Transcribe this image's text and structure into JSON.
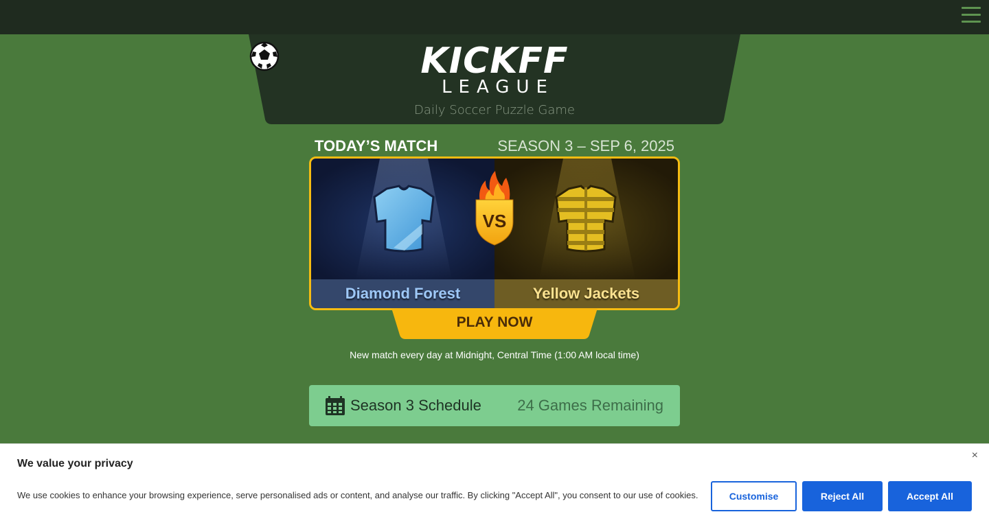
{
  "header": {
    "logo_word_part1": "KICK",
    "logo_word_part2": "FF",
    "logo_league": "LEAGUE",
    "tagline": "Daily Soccer Puzzle Game",
    "menu_icon": "hamburger-menu-icon"
  },
  "match": {
    "heading": "TODAY’S MATCH",
    "season_date": "SEASON 3 – SEP 6, 2025",
    "home_team": "Diamond Forest",
    "away_team": "Yellow Jackets",
    "vs_label": "VS",
    "play_label": "PLAY NOW",
    "info": "New match every day at Midnight, Central Time (1:00 AM local time)",
    "colors": {
      "home_jersey": "#62b3e6",
      "away_jersey": "#e4be22",
      "accent": "#f6bc12"
    }
  },
  "schedule": {
    "label": "Season 3 Schedule",
    "remaining": "24 Games Remaining",
    "icon": "calendar-icon"
  },
  "cookie": {
    "title": "We value your privacy",
    "text": "We use cookies to enhance your browsing experience, serve personalised ads or content, and analyse our traffic. By clicking \"Accept All\", you consent to our use of cookies.",
    "close": "×",
    "customise": "Customise",
    "reject": "Reject All",
    "accept": "Accept All"
  }
}
